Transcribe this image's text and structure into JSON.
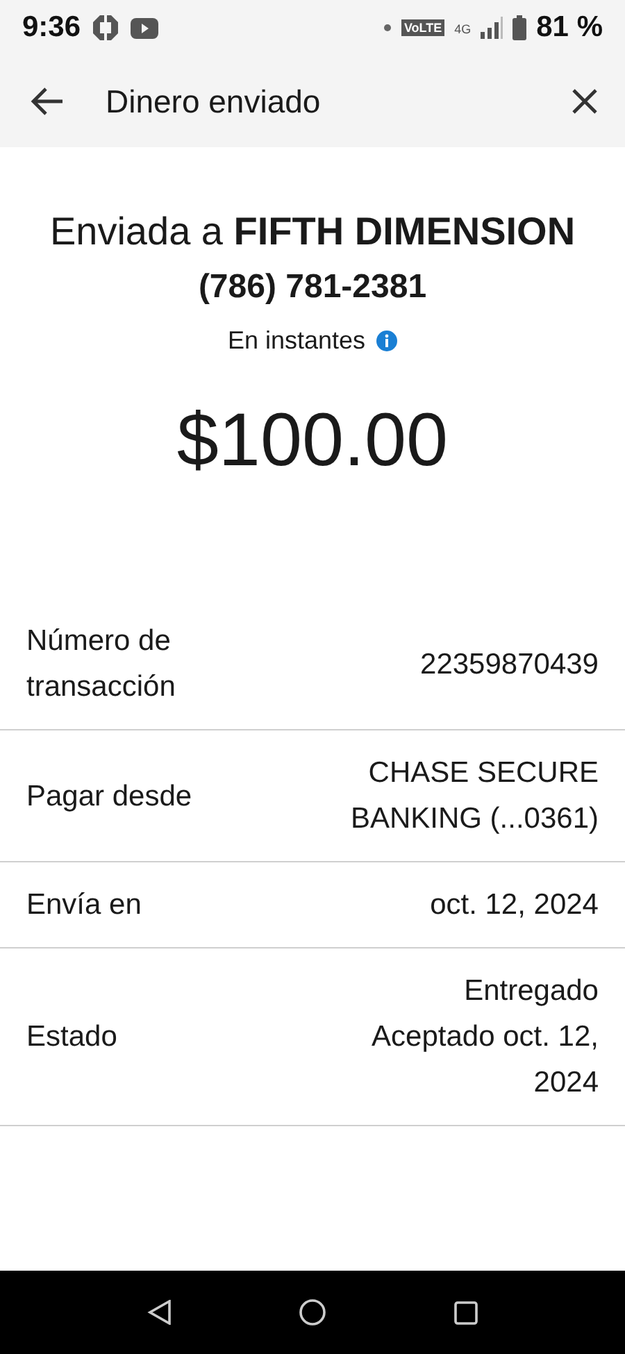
{
  "status_bar": {
    "time": "9:36",
    "volte": "VoLTE",
    "network": "4G",
    "battery": "81 %"
  },
  "app_bar": {
    "title": "Dinero enviado"
  },
  "summary": {
    "title": "Enviada a **FIFTH DIMENSION**",
    "phone": "(786) 781-2381",
    "speed": "En instantes",
    "amount": "$100.00"
  },
  "details": [
    {
      "label": "Número de transacción",
      "values": [
        "22359870439"
      ]
    },
    {
      "label": "Pagar desde",
      "values": [
        "CHASE SECURE BANKING (...0361)"
      ]
    },
    {
      "label": "Envía en",
      "values": [
        "oct. 12, 2024"
      ]
    },
    {
      "label": "Estado",
      "values": [
        "Entregado",
        "Aceptado oct. 12, 2024"
      ]
    }
  ]
}
